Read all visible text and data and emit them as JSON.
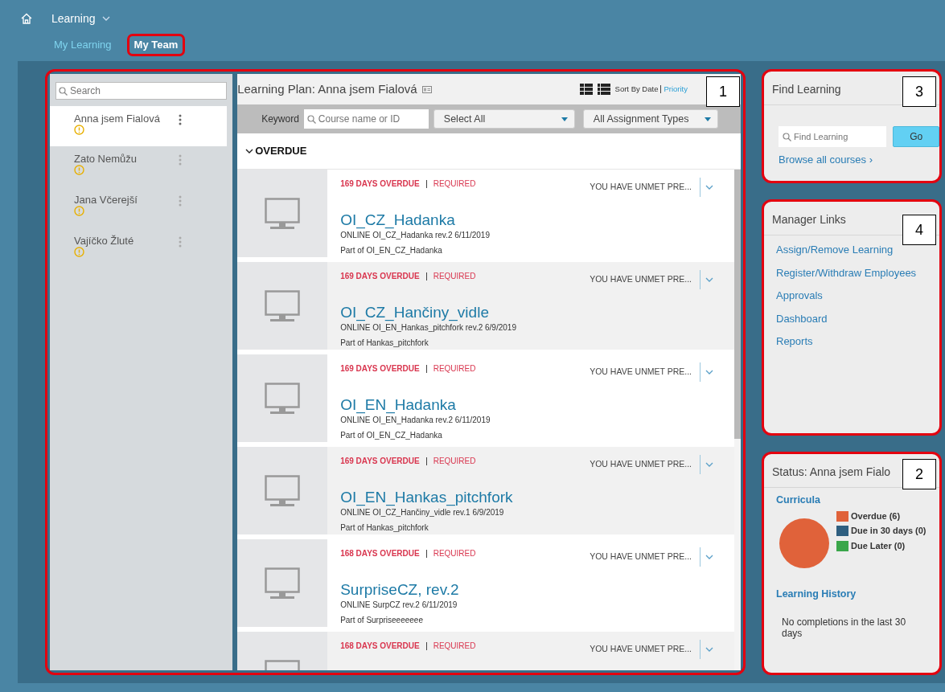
{
  "app": {
    "title": "Learning"
  },
  "tabs": [
    {
      "label": "My Learning",
      "selected": false,
      "highlighted": false
    },
    {
      "label": "My Team",
      "selected": true,
      "highlighted": true
    }
  ],
  "team": {
    "callout": "1",
    "search": {
      "placeholder": "Search"
    },
    "members": [
      {
        "name": "Anna jsem Fialová",
        "selected": true
      },
      {
        "name": "Zato Nemůžu",
        "selected": false
      },
      {
        "name": "Jana Včerejší",
        "selected": false
      },
      {
        "name": "Vajíčko Žluté",
        "selected": false
      }
    ]
  },
  "plan": {
    "title": "Learning Plan: Anna jsem Fialová",
    "sort_label": "Sort By Date",
    "sort_link": "Priority",
    "keyword_label": "Keyword",
    "keyword_placeholder": "Course name or ID",
    "select": "Select All",
    "types": "All Assignment Types",
    "section": "OVERDUE",
    "courses": [
      {
        "overdue": "169 DAYS OVERDUE",
        "required": "REQUIRED",
        "prereq": "YOU HAVE UNMET PRE...",
        "title": "OI_CZ_Hadanka",
        "details": "ONLINE OI_CZ_Hadanka rev.2 6/11/2019",
        "part_of": "Part of OI_EN_CZ_Hadanka"
      },
      {
        "overdue": "169 DAYS OVERDUE",
        "required": "REQUIRED",
        "prereq": "YOU HAVE UNMET PRE...",
        "title": "OI_CZ_Hančiny_vidle",
        "details": "ONLINE OI_EN_Hankas_pitchfork rev.2 6/9/2019",
        "part_of": "Part of Hankas_pitchfork"
      },
      {
        "overdue": "169 DAYS OVERDUE",
        "required": "REQUIRED",
        "prereq": "YOU HAVE UNMET PRE...",
        "title": "OI_EN_Hadanka",
        "details": "ONLINE OI_EN_Hadanka rev.2 6/11/2019",
        "part_of": "Part of OI_EN_CZ_Hadanka"
      },
      {
        "overdue": "169 DAYS OVERDUE",
        "required": "REQUIRED",
        "prereq": "YOU HAVE UNMET PRE...",
        "title": "OI_EN_Hankas_pitchfork",
        "details": "ONLINE OI_CZ_Hančiny_vidle rev.1 6/9/2019",
        "part_of": "Part of Hankas_pitchfork"
      },
      {
        "overdue": "168 DAYS OVERDUE",
        "required": "REQUIRED",
        "prereq": "YOU HAVE UNMET PRE...",
        "title": "SurpriseCZ, rev.2",
        "details": "ONLINE SurpCZ rev.2 6/11/2019",
        "part_of": "Part of Surpriseeeeeee"
      },
      {
        "overdue": "168 DAYS OVERDUE",
        "required": "REQUIRED",
        "prereq": "YOU HAVE UNMET PRE..."
      }
    ]
  },
  "find": {
    "callout": "3",
    "title": "Find Learning",
    "placeholder": "Find Learning",
    "button": "Go",
    "browse": "Browse all courses ›"
  },
  "manager": {
    "callout": "4",
    "title": "Manager Links",
    "links": [
      "Assign/Remove Learning",
      "Register/Withdraw Employees",
      "Approvals",
      "Dashboard",
      "Reports"
    ]
  },
  "status": {
    "callout": "2",
    "title": "Status: Anna jsem Fialo",
    "curricula": "Curricula",
    "legend": [
      {
        "color": "#e0623a"
      },
      {
        "color": "#2f5f80"
      },
      {
        "color": "#3aa64a"
      }
    ],
    "chart_data": {
      "type": "pie",
      "categories": [
        "Overdue (6)",
        "Due in 30 days (0)",
        "Due Later (0)"
      ],
      "values": [
        100,
        0,
        0
      ]
    },
    "history": "Learning History",
    "history_text": "No completions in the last 30 days"
  }
}
